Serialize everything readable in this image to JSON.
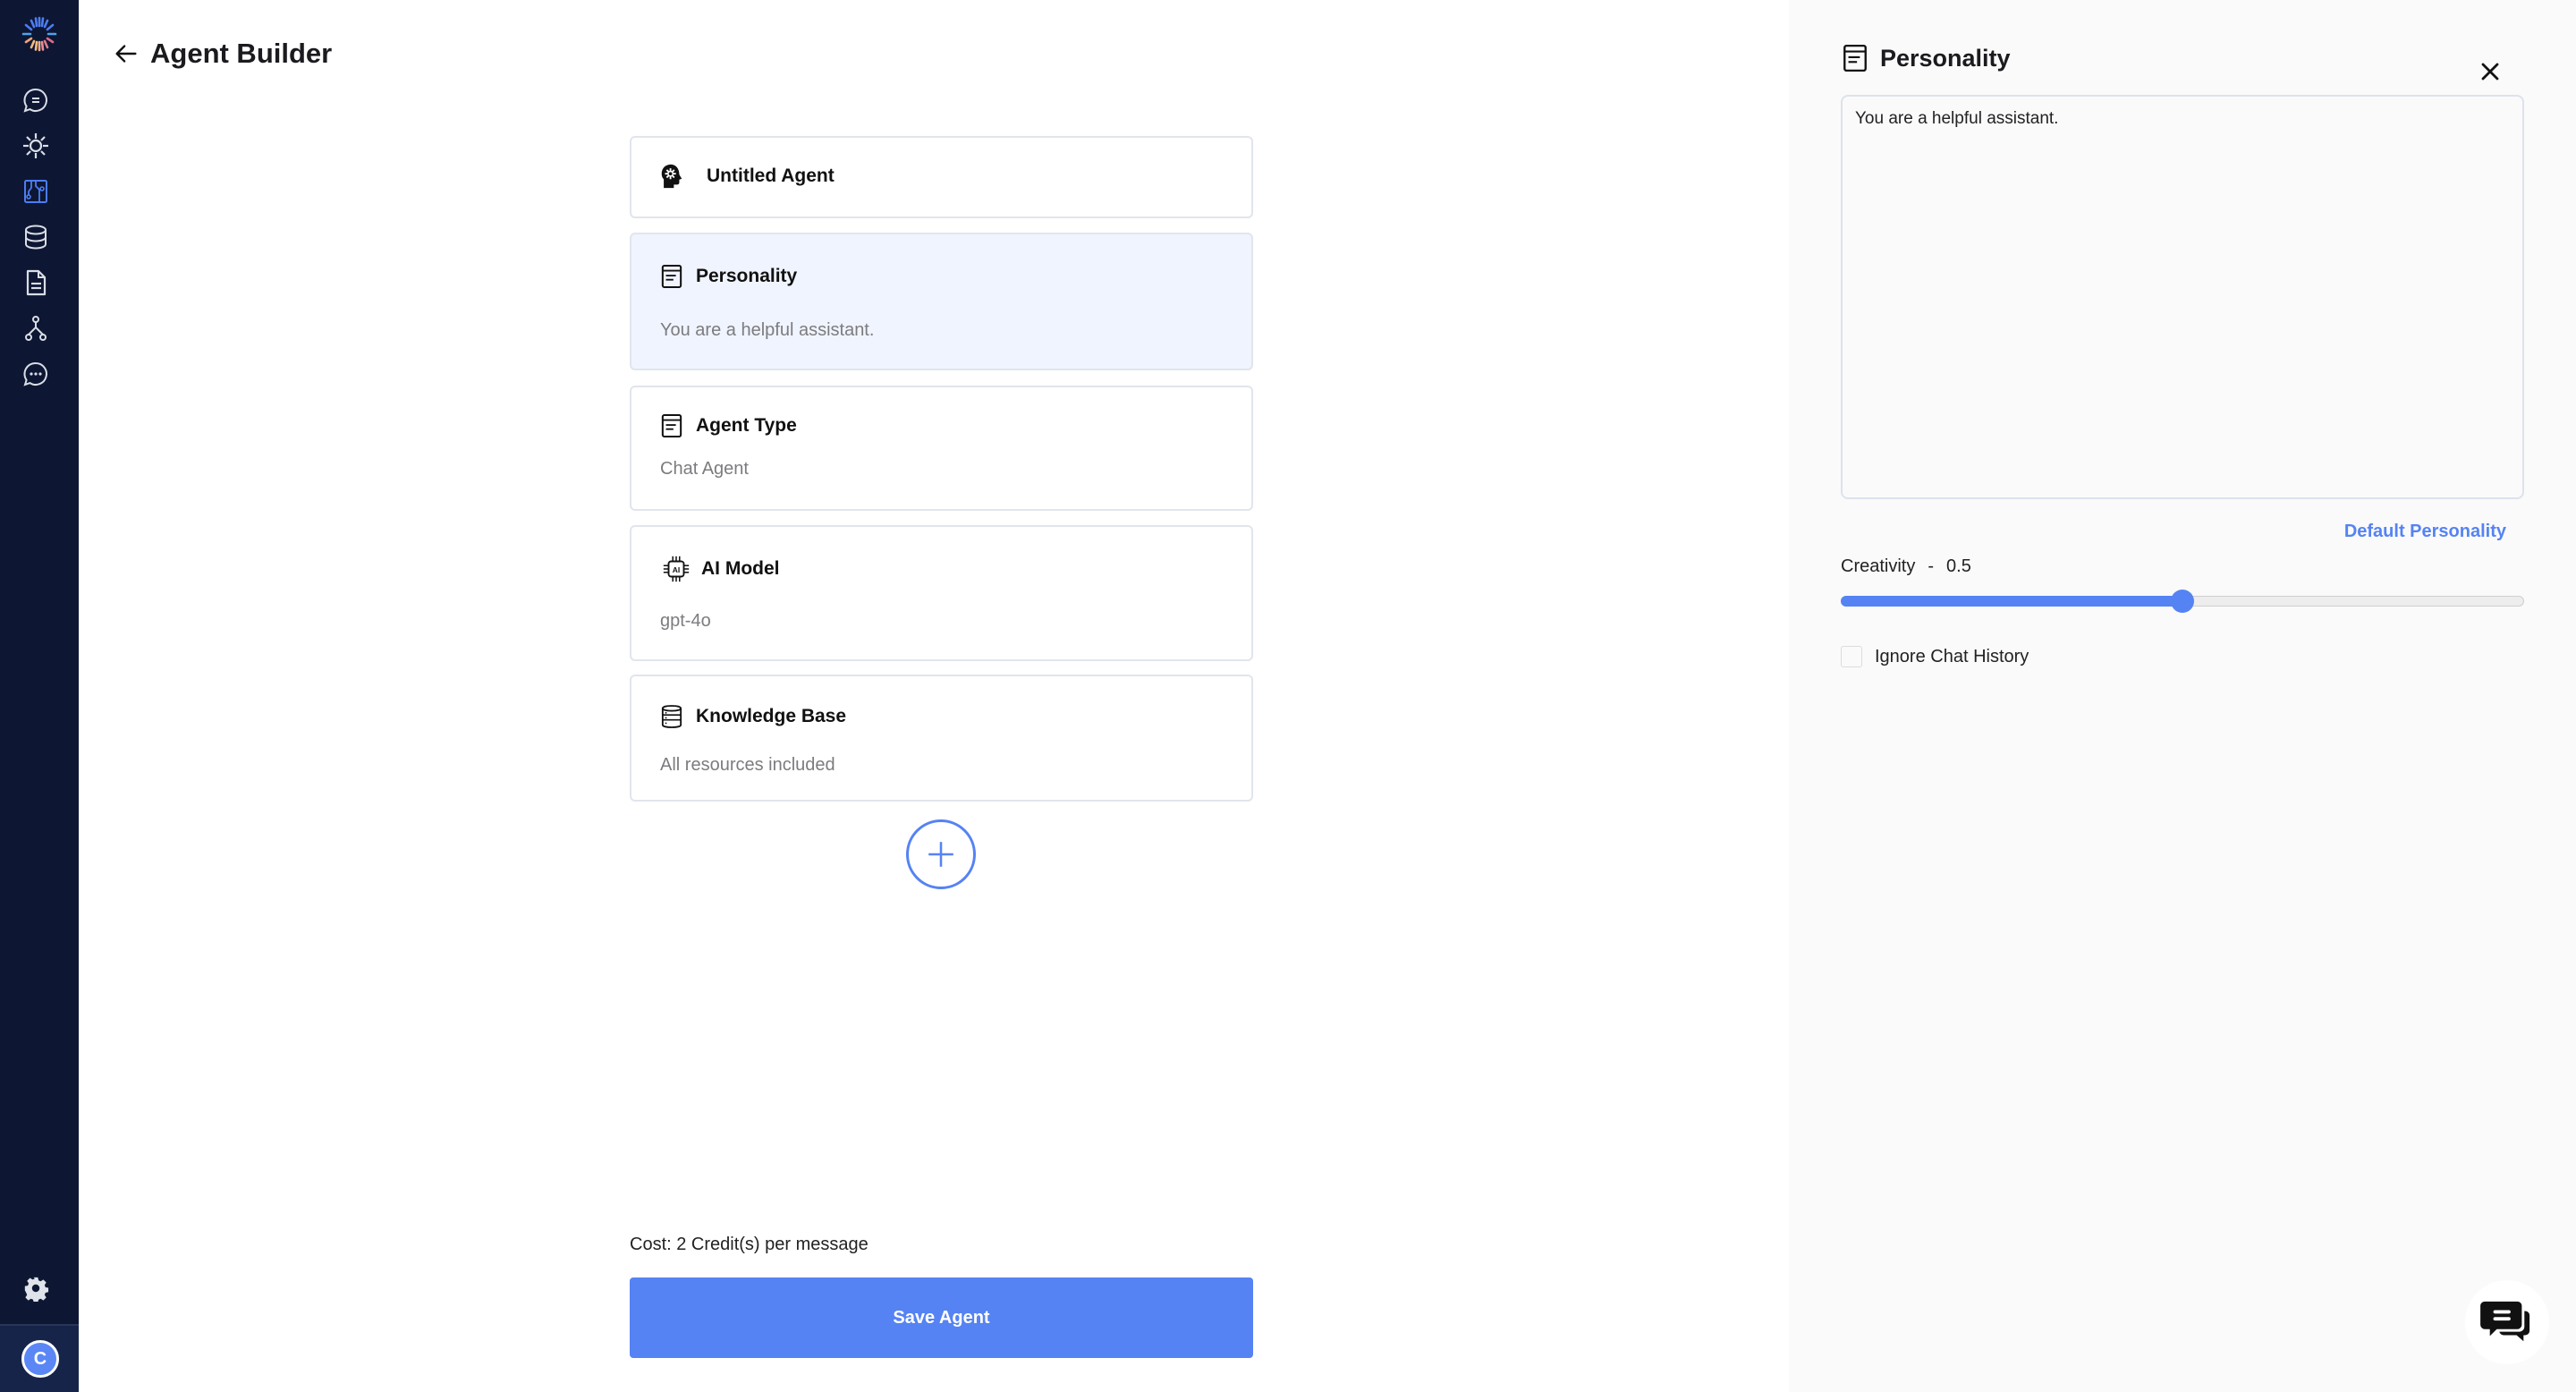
{
  "sidebar": {
    "logo": "brand-logo",
    "items": [
      {
        "name": "chat",
        "icon": "chat-bubble-icon",
        "active": false
      },
      {
        "name": "integrations",
        "icon": "sun-icon",
        "active": false
      },
      {
        "name": "agent-builder",
        "icon": "circuit-board-icon",
        "active": true
      },
      {
        "name": "database",
        "icon": "database-icon",
        "active": false
      },
      {
        "name": "documents",
        "icon": "document-icon",
        "active": false
      },
      {
        "name": "workflows",
        "icon": "flow-icon",
        "active": false
      },
      {
        "name": "conversations",
        "icon": "chat-dots-icon",
        "active": false
      }
    ],
    "settings_icon": "gear-icon",
    "avatar_initial": "C"
  },
  "header": {
    "title": "Agent Builder",
    "back_icon": "arrow-left-icon"
  },
  "cards": [
    {
      "title": "Untitled Agent",
      "subtitle": null,
      "icon": "head-gear-icon",
      "active": false
    },
    {
      "title": "Personality",
      "subtitle": "You are a helpful assistant.",
      "icon": "document-lines-icon",
      "active": true
    },
    {
      "title": "Agent Type",
      "subtitle": "Chat Agent",
      "icon": "document-lines-icon",
      "active": false
    },
    {
      "title": "AI Model",
      "subtitle": "gpt-4o",
      "icon": "ai-chip-icon",
      "active": false
    },
    {
      "title": "Knowledge Base",
      "subtitle": "All resources included",
      "icon": "database-list-icon",
      "active": false
    }
  ],
  "add_block_icon": "plus-circle-icon",
  "cost": "Cost: 2 Credit(s) per message",
  "save_label": "Save Agent",
  "panel": {
    "title": "Personality",
    "prompt_value": "You are a helpful assistant.",
    "default_link": "Default Personality",
    "creativity_label": "Creativity",
    "creativity_sep": "-",
    "creativity_value": "0.5",
    "creativity_fraction": 0.5,
    "ignore_history_label": "Ignore Chat History",
    "ignore_history_checked": false
  },
  "colors": {
    "accent": "#5583f3",
    "sidebar_bg": "#0d1733",
    "active_card_bg": "#f0f4fe",
    "panel_bg": "#fafafa"
  }
}
